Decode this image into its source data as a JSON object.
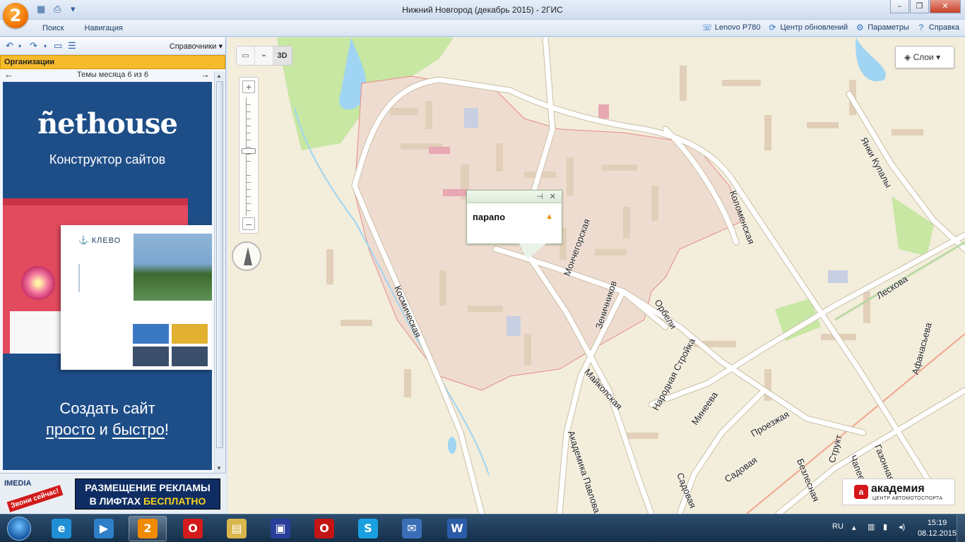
{
  "window": {
    "title": "Нижний Новгород (декабрь 2015) - 2ГИС",
    "logo": "2",
    "controls": [
      "–",
      "❐",
      "✕"
    ]
  },
  "menubar": {
    "tabs": [
      "Поиск",
      "Навигация"
    ],
    "right_items": [
      {
        "label": "Lenovo P780",
        "icon": "phone-icon"
      },
      {
        "label": "Центр обновлений",
        "icon": "refresh-icon"
      },
      {
        "label": "Параметры",
        "icon": "gear-icon"
      },
      {
        "label": "Справка",
        "icon": "help-icon"
      }
    ]
  },
  "left_panel": {
    "dictionaries_label": "Справочники",
    "organizations_label": "Организации",
    "themes_label": "Темы месяца 6 из 6",
    "ad": {
      "brand": "ñethouse",
      "tagline": "Конструктор сайтов",
      "mock_logo": "КЛЕВО",
      "cta_line1": "Создать сайт",
      "cta_word1": "просто",
      "cta_and": "и",
      "cta_word2": "быстро",
      "cta_end": "!"
    },
    "bottom_ad": {
      "brand": "IMEDIA",
      "call_now": "Звони сейчас!",
      "line1": "РАЗМЕЩЕНИЕ РЕКЛАМЫ",
      "line2_prefix": "В ЛИФТАХ",
      "line2_highlight": "БЕСПЛАТНО"
    }
  },
  "map": {
    "tools": [
      "▭",
      "⌁",
      "3D"
    ],
    "layers_label": "Слои",
    "popup_text": "парапо",
    "streets": [
      {
        "name": "Космическая"
      },
      {
        "name": "Мончегорская"
      },
      {
        "name": "Зеничников"
      },
      {
        "name": "Орбели"
      },
      {
        "name": "Коломенская"
      },
      {
        "name": "Янки Купалы"
      },
      {
        "name": "Лескова"
      },
      {
        "name": "Народная Стройка"
      },
      {
        "name": "Майкопская"
      },
      {
        "name": "Академика Павлова"
      },
      {
        "name": "Минеева"
      },
      {
        "name": "Проезжая"
      },
      {
        "name": "Садовая"
      },
      {
        "name": "Садовая"
      },
      {
        "name": "Безлесная"
      },
      {
        "name": "Структ"
      },
      {
        "name": "Чапее"
      },
      {
        "name": "Газонная"
      },
      {
        "name": "Афанасьева"
      }
    ],
    "sponsor": {
      "mark": "a",
      "name": "академия",
      "sub": "ЦЕНТР АВТОМОТОСПОРТА"
    },
    "colors": {
      "land": "#f3eddb",
      "district": "#efdcd0",
      "park": "#c7e7a3",
      "water": "#9fd5f2",
      "road": "#ffffff"
    }
  },
  "taskbar": {
    "apps": [
      {
        "name": "ie",
        "glyph": "e",
        "color": "#1f8fd6"
      },
      {
        "name": "media",
        "glyph": "▶",
        "color": "#2e7fc8"
      },
      {
        "name": "2gis",
        "glyph": "2",
        "color": "#f08a00"
      },
      {
        "name": "opera",
        "glyph": "O",
        "color": "#d31b1b"
      },
      {
        "name": "explorer",
        "glyph": "▤",
        "color": "#d9b54d"
      },
      {
        "name": "save",
        "glyph": "▣",
        "color": "#2a3d9a"
      },
      {
        "name": "opera2",
        "glyph": "O",
        "color": "#c31515"
      },
      {
        "name": "skype",
        "glyph": "S",
        "color": "#1aa0e0"
      },
      {
        "name": "thunderbird",
        "glyph": "✉",
        "color": "#3a6fb8"
      },
      {
        "name": "word",
        "glyph": "W",
        "color": "#2b5ca8"
      }
    ],
    "lang": "RU",
    "time": "15:19",
    "date": "08.12.2015"
  }
}
